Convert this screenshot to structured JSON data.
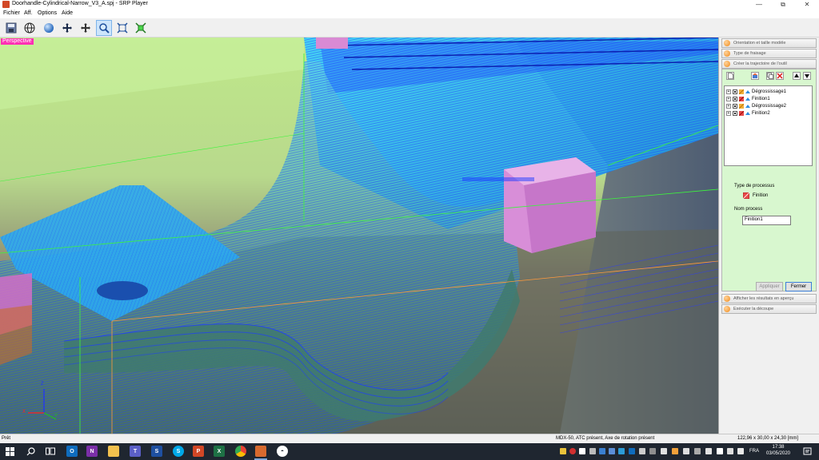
{
  "window": {
    "title": "Doorhandle-Cylindrical-Narrow_V3_A.spj - SRP Player",
    "minimize_glyph": "—",
    "maximize_glyph": "⧉",
    "close_glyph": "✕"
  },
  "menu": {
    "items": [
      "Fichier",
      "Aff.",
      "Options",
      "Aide"
    ]
  },
  "toolbar": {
    "icons": [
      "save-icon",
      "globe-grid-icon",
      "sphere-shaded-icon",
      "rotate-move-icon",
      "pan-icon",
      "zoom-icon",
      "fit-view-icon",
      "fit-all-icon"
    ],
    "active": "zoom-icon"
  },
  "viewport": {
    "view_label": "Perspective",
    "axes": {
      "x": "X",
      "y": "Y",
      "z": "Z"
    }
  },
  "panel": {
    "steps_top": [
      "Orientation et taille modèle",
      "Type de fraisage",
      "Créer la trajectoire de l'outil"
    ],
    "steps_bottom": [
      "Afficher les résultats en aperçu",
      "Exécuter la découpe"
    ],
    "tree": [
      {
        "label": "Dégrossissage1",
        "kind": "roughing"
      },
      {
        "label": "Finition1",
        "kind": "finishing"
      },
      {
        "label": "Dégrossissage2",
        "kind": "roughing"
      },
      {
        "label": "Finition2",
        "kind": "finishing"
      }
    ],
    "process_type_label": "Type de processus",
    "process_type_value": "Finition",
    "process_name_label": "Nom process",
    "process_name_value": "Finition1",
    "apply_label": "Appliquer",
    "close_label": "Fermer"
  },
  "status": {
    "left": "Prêt",
    "machine": "MDX-50, ATC présent, Axe de rotation présent",
    "dimensions": "122,96 x 30,00 x 24,30 [mm]"
  },
  "taskbar": {
    "language": "FRA",
    "time": "17:38",
    "date": "03/05/2020"
  },
  "colors": {
    "accent_pink": "#ff2fb4",
    "toolpath_blue": "#1e3cff",
    "panel_green": "#d8f7cf",
    "step_orange": "#f08a1a"
  }
}
